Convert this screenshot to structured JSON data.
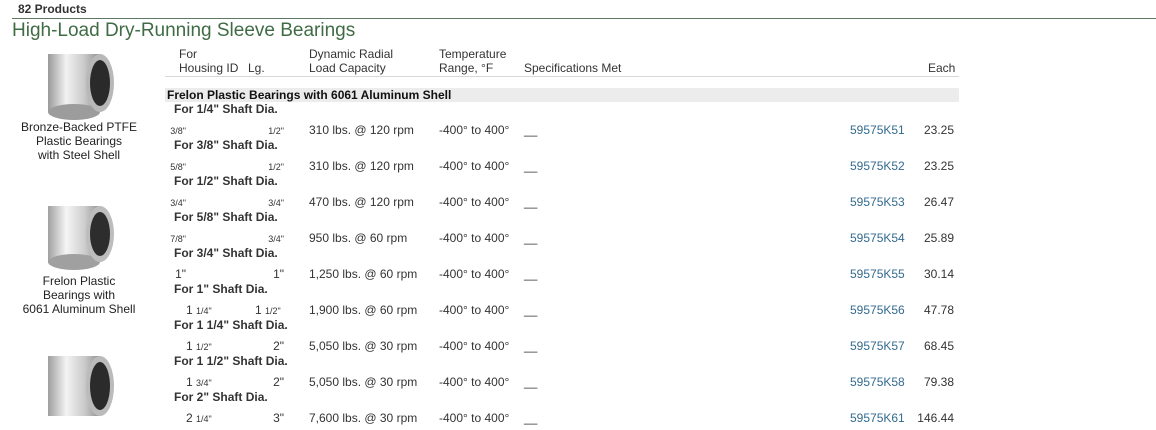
{
  "header": {
    "count": "82 Products",
    "title": "High-Load Dry-Running Sleeve Bearings"
  },
  "images": [
    {
      "caption": [
        "Bronze-Backed PTFE",
        "Plastic Bearings",
        "with Steel Shell"
      ]
    },
    {
      "caption": [
        "Frelon Plastic",
        "Bearings with",
        "6061 Aluminum Shell"
      ]
    },
    {
      "caption": []
    }
  ],
  "columns": {
    "for": "For",
    "housing_id": "Housing ID",
    "lg": "Lg.",
    "load_1": "Dynamic Radial",
    "load_2": "Load Capacity",
    "temp_1": "Temperature",
    "temp_2": "Range, °F",
    "spec": "Specifications Met",
    "each": "Each"
  },
  "section": {
    "title": "Frelon Plastic Bearings with 6061 Aluminum Shell"
  },
  "rows": [
    {
      "group": "For 1/4\" Shaft Dia.",
      "housing_id": "3/8\"",
      "lg": "1/2\"",
      "load": "310 lbs. @ 120 rpm",
      "temp": "-400° to 400°",
      "spec": "__",
      "part": "59575K51",
      "each": "23.25"
    },
    {
      "group": "For 3/8\" Shaft Dia.",
      "housing_id": "5/8\"",
      "lg": "1/2\"",
      "load": "310 lbs. @ 120 rpm",
      "temp": "-400° to 400°",
      "spec": "__",
      "part": "59575K52",
      "each": "23.25"
    },
    {
      "group": "For 1/2\" Shaft Dia.",
      "housing_id": "3/4\"",
      "lg": "3/4\"",
      "load": "470 lbs. @ 120 rpm",
      "temp": "-400° to 400°",
      "spec": "__",
      "part": "59575K53",
      "each": "26.47"
    },
    {
      "group": "For 5/8\" Shaft Dia.",
      "housing_id": "7/8\"",
      "lg": "3/4\"",
      "load": "950 lbs. @ 60 rpm",
      "temp": "-400° to 400°",
      "spec": "__",
      "part": "59575K54",
      "each": "25.89"
    },
    {
      "group": "For 3/4\" Shaft Dia.",
      "housing_id": "1\"",
      "lg": "1\"",
      "load": "1,250 lbs. @ 60 rpm",
      "temp": "-400° to 400°",
      "spec": "__",
      "part": "59575K55",
      "each": "30.14"
    },
    {
      "group": "For 1\" Shaft Dia.",
      "housing_id_whole": "1",
      "housing_id_frac": "1/4\"",
      "lg_whole": "1",
      "lg_frac": "1/2\"",
      "load": "1,900 lbs. @ 60 rpm",
      "temp": "-400° to 400°",
      "spec": "__",
      "part": "59575K56",
      "each": "47.78"
    },
    {
      "group": "For 1 1/4\" Shaft Dia.",
      "housing_id_whole": "1",
      "housing_id_frac": "1/2\"",
      "lg": "2\"",
      "load": "5,050 lbs. @ 30 rpm",
      "temp": "-400° to 400°",
      "spec": "__",
      "part": "59575K57",
      "each": "68.45"
    },
    {
      "group": "For 1 1/2\" Shaft Dia.",
      "housing_id_whole": "1",
      "housing_id_frac": "3/4\"",
      "lg": "2\"",
      "load": "5,050 lbs. @ 30 rpm",
      "temp": "-400° to 400°",
      "spec": "__",
      "part": "59575K58",
      "each": "79.38"
    },
    {
      "group": "For 2\" Shaft Dia.",
      "housing_id_whole": "2",
      "housing_id_frac": "1/4\"",
      "lg": "3\"",
      "load": "7,600 lbs. @ 30 rpm",
      "temp": "-400° to 400°",
      "spec": "__",
      "part": "59575K61",
      "each": "146.44"
    }
  ]
}
